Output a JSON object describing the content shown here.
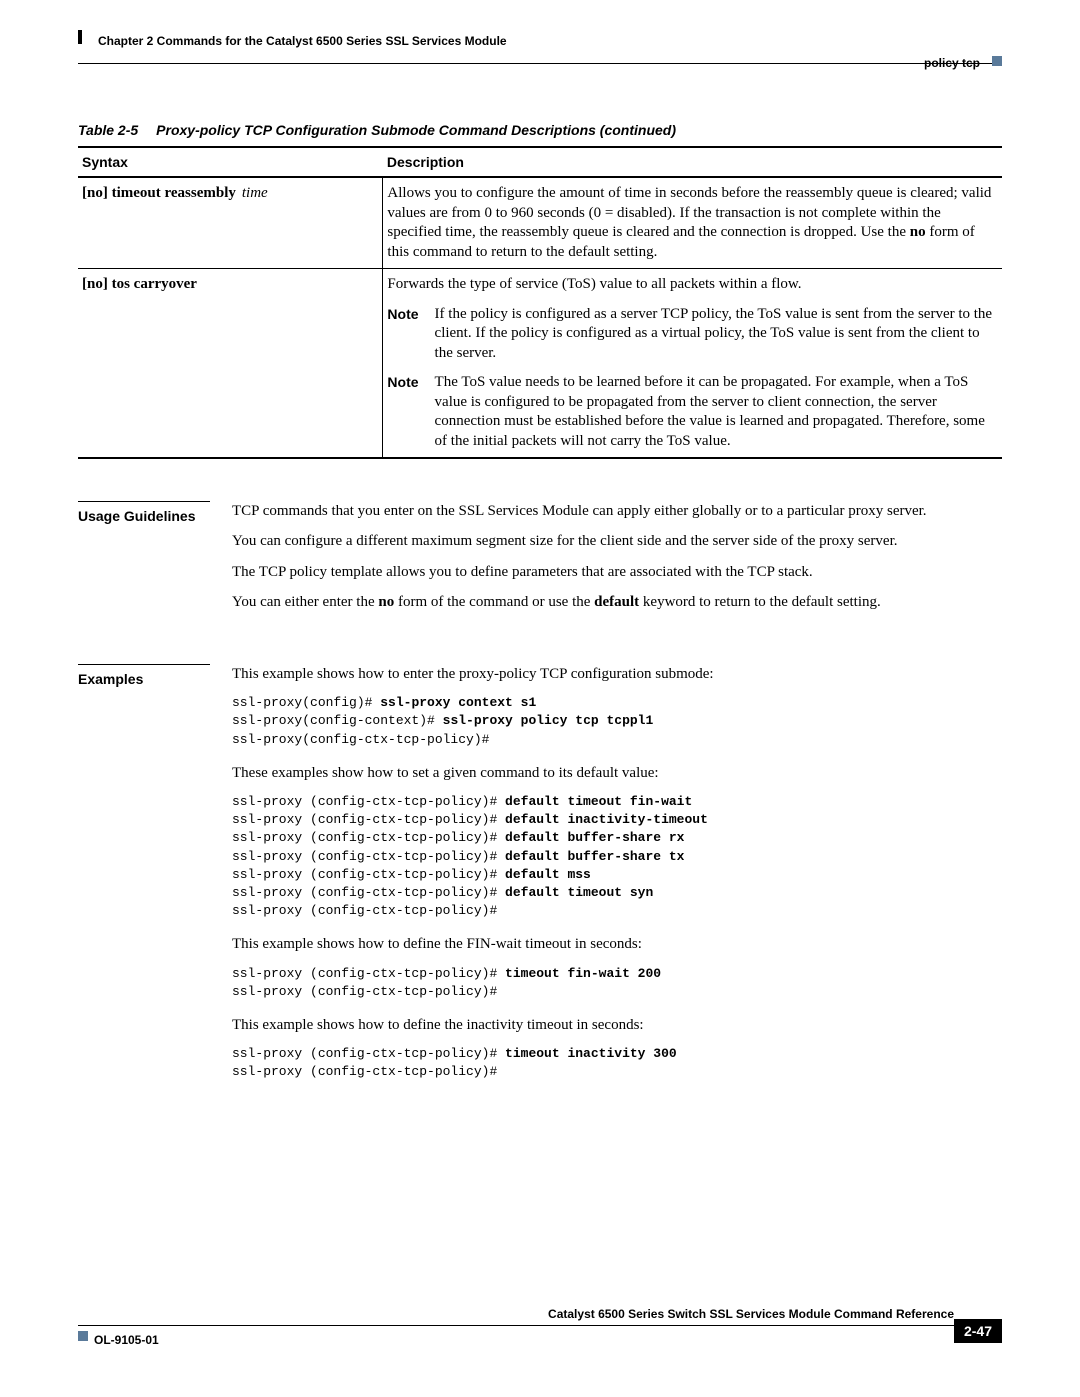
{
  "header": {
    "chapter": "Chapter 2      Commands for the Catalyst 6500 Series SSL Services Module",
    "topic": "policy tcp"
  },
  "table": {
    "caption_num": "Table 2-5",
    "caption_title": "Proxy-policy TCP Configuration Submode Command Descriptions (continued)",
    "col_syntax": "Syntax",
    "col_desc": "Description",
    "rows": [
      {
        "syntax_prefix": "[no] timeout reassembly",
        "syntax_arg": "time",
        "desc_pre": "Allows you to configure the amount of time in seconds before the reassembly queue is cleared; valid values are from 0 to 960 seconds (0 = disabled). If the transaction is not complete within the specified time, the reassembly queue is cleared and the connection is dropped. Use the ",
        "desc_bold": "no",
        "desc_post": " form of this command to return to the default setting."
      },
      {
        "syntax_prefix": "[no] tos carryover",
        "syntax_arg": "",
        "desc": "Forwards the type of service (ToS) value to all packets within a flow.",
        "note1_label": "Note",
        "note1": "If the policy is configured as a server TCP policy, the ToS value is sent from the server to the client. If the policy is configured as a virtual policy, the ToS value is sent from the client to the server.",
        "note2_label": "Note",
        "note2": "The ToS value needs to be learned before it can be propagated. For example, when a ToS value is configured to be propagated from the server to client connection, the server connection must be established before the value is learned and propagated. Therefore, some of the initial packets will not carry the ToS value."
      }
    ]
  },
  "usage": {
    "label": "Usage Guidelines",
    "p1": "TCP commands that you enter on the SSL Services Module can apply either globally or to a particular proxy server.",
    "p2": "You can configure a different maximum segment size for the client side and the server side of the proxy server.",
    "p3": "The TCP policy template allows you to define parameters that are associated with the TCP stack.",
    "p4_pre": "You can either enter the ",
    "p4_b1": "no",
    "p4_mid": " form of the command or use the ",
    "p4_b2": "default",
    "p4_post": " keyword to return to the default setting."
  },
  "examples": {
    "label": "Examples",
    "p1": "This example shows how to enter the proxy-policy TCP configuration submode:",
    "c1_l1a": "ssl-proxy(config)# ",
    "c1_l1b": "ssl-proxy context s1",
    "c1_l2a": "ssl-proxy(config-context)# ",
    "c1_l2b": "ssl-proxy policy tcp tcppl1",
    "c1_l3": "ssl-proxy(config-ctx-tcp-policy)#",
    "p2": "These examples show how to set a given command to its default value:",
    "c2_prompt": "ssl-proxy (config-ctx-tcp-policy)# ",
    "c2_b1": "default timeout fin-wait",
    "c2_b2": "default inactivity-timeout",
    "c2_b3": "default buffer-share rx",
    "c2_b4": "default buffer-share tx",
    "c2_b5": "default mss",
    "c2_b6": "default timeout syn",
    "c2_last": "ssl-proxy (config-ctx-tcp-policy)#",
    "p3": "This example shows how to define the FIN-wait timeout in seconds:",
    "c3_b": "timeout fin-wait 200",
    "p4": "This example shows how to define the inactivity timeout in seconds:",
    "c4_b": "timeout inactivity 300"
  },
  "footer": {
    "doc_title": "Catalyst 6500 Series Switch SSL Services Module Command Reference",
    "docid": "OL-9105-01",
    "pagenum": "2-47"
  }
}
